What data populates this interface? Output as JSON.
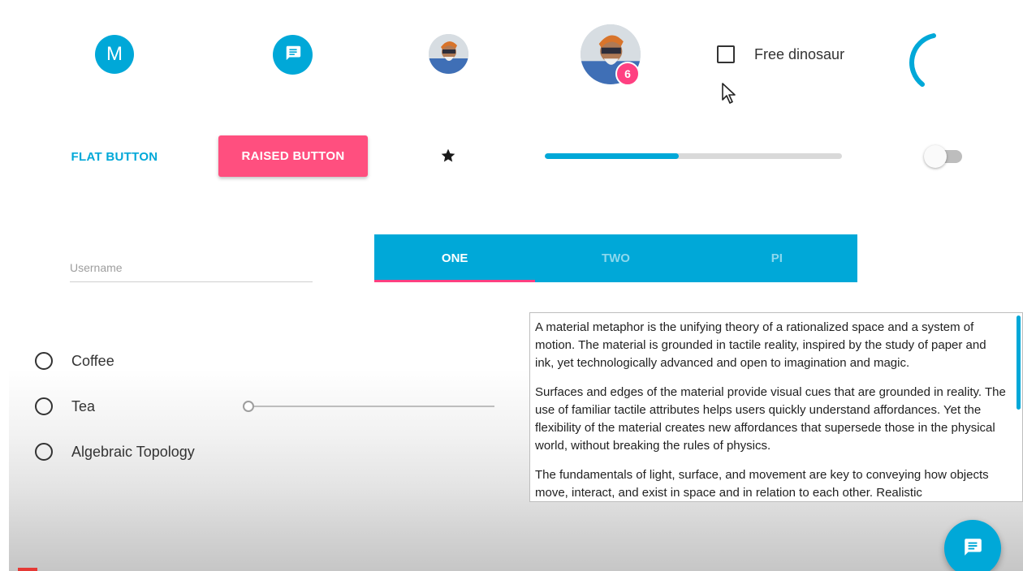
{
  "avatars": {
    "letter": "M",
    "badge_count": "6",
    "colors": {
      "primary": "#00a8d8",
      "badge": "#ff4081"
    },
    "icon": "chat-icon"
  },
  "checkbox": {
    "label": "Free dinosaur",
    "checked": false
  },
  "buttons": {
    "flat_label": "FLAT BUTTON",
    "raised_label": "RAISED BUTTON",
    "raised_color": "#ff4f7f"
  },
  "progress": {
    "value": 0.45
  },
  "toggle": {
    "on": false
  },
  "username": {
    "placeholder": "Username",
    "value": ""
  },
  "tabs": [
    {
      "label": "ONE",
      "active": true
    },
    {
      "label": "TWO",
      "active": false
    },
    {
      "label": "PI",
      "active": false
    }
  ],
  "radios": [
    {
      "label": "Coffee",
      "checked": false
    },
    {
      "label": "Tea",
      "checked": false
    },
    {
      "label": "Algebraic Topology",
      "checked": false
    }
  ],
  "slider": {
    "value": 0
  },
  "textbox": {
    "paragraphs": [
      "A material metaphor is the unifying theory of a rationalized space and a system of motion. The material is grounded in tactile reality, inspired by the study of paper and ink, yet technologically advanced and open to imagination and magic.",
      "Surfaces and edges of the material provide visual cues that are grounded in reality. The use of familiar tactile attributes helps users quickly understand affordances. Yet the flexibility of the material creates new affordances that supersede those in the physical world, without breaking the rules of physics.",
      "The fundamentals of light, surface, and movement are key to conveying how objects move, interact, and exist in space and in relation to each other. Realistic"
    ]
  },
  "fab": {
    "icon": "chat-icon"
  }
}
